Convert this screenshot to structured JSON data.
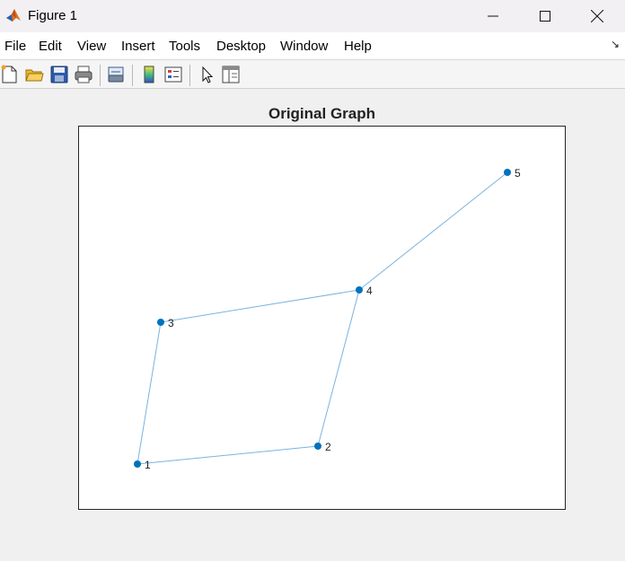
{
  "window": {
    "title": "Figure 1"
  },
  "menu": [
    "File",
    "Edit",
    "View",
    "Insert",
    "Tools",
    "Desktop",
    "Window",
    "Help"
  ],
  "toolbar": {
    "icons": [
      "new-file-icon",
      "open-folder-icon",
      "save-icon",
      "print-icon",
      "link-plot-icon",
      "colorbar-icon",
      "legend-icon",
      "pointer-icon",
      "property-editor-icon"
    ]
  },
  "plot": {
    "title": "Original Graph"
  },
  "colors": {
    "edge": "#7ab3df",
    "node": "#0072bd",
    "axes_border": "#262626"
  },
  "chart_data": {
    "type": "graph",
    "title": "Original Graph",
    "grid": false,
    "nodes": [
      {
        "id": "1",
        "label": "1"
      },
      {
        "id": "2",
        "label": "2"
      },
      {
        "id": "3",
        "label": "3"
      },
      {
        "id": "4",
        "label": "4"
      },
      {
        "id": "5",
        "label": "5"
      }
    ],
    "edges": [
      [
        "1",
        "2"
      ],
      [
        "1",
        "3"
      ],
      [
        "2",
        "4"
      ],
      [
        "3",
        "4"
      ],
      [
        "4",
        "5"
      ]
    ]
  }
}
